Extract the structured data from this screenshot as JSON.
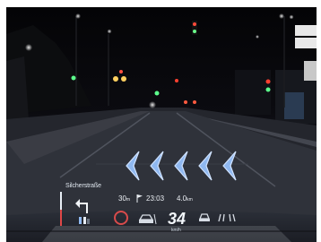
{
  "hud": {
    "street_name": "Silcherstraße",
    "next_distance": "30",
    "next_distance_unit": "m",
    "eta": "23:03",
    "remaining_distance": "4.0",
    "remaining_distance_unit": "km",
    "speed": "34",
    "speed_unit": "km/h",
    "accent_color": "#8fb8f0",
    "limit_ring_color": "#d84b4b"
  },
  "icons": {
    "turn": "turn-left-arrow-icon",
    "lane": "lane-guidance-icon",
    "destination": "flag-icon",
    "speed_limit": "speed-limit-sign-icon",
    "car_assist": "car-assist-icon",
    "car": "car-icon",
    "assist": "steering-assist-icon",
    "chevrons": "navigation-chevron-icon"
  }
}
